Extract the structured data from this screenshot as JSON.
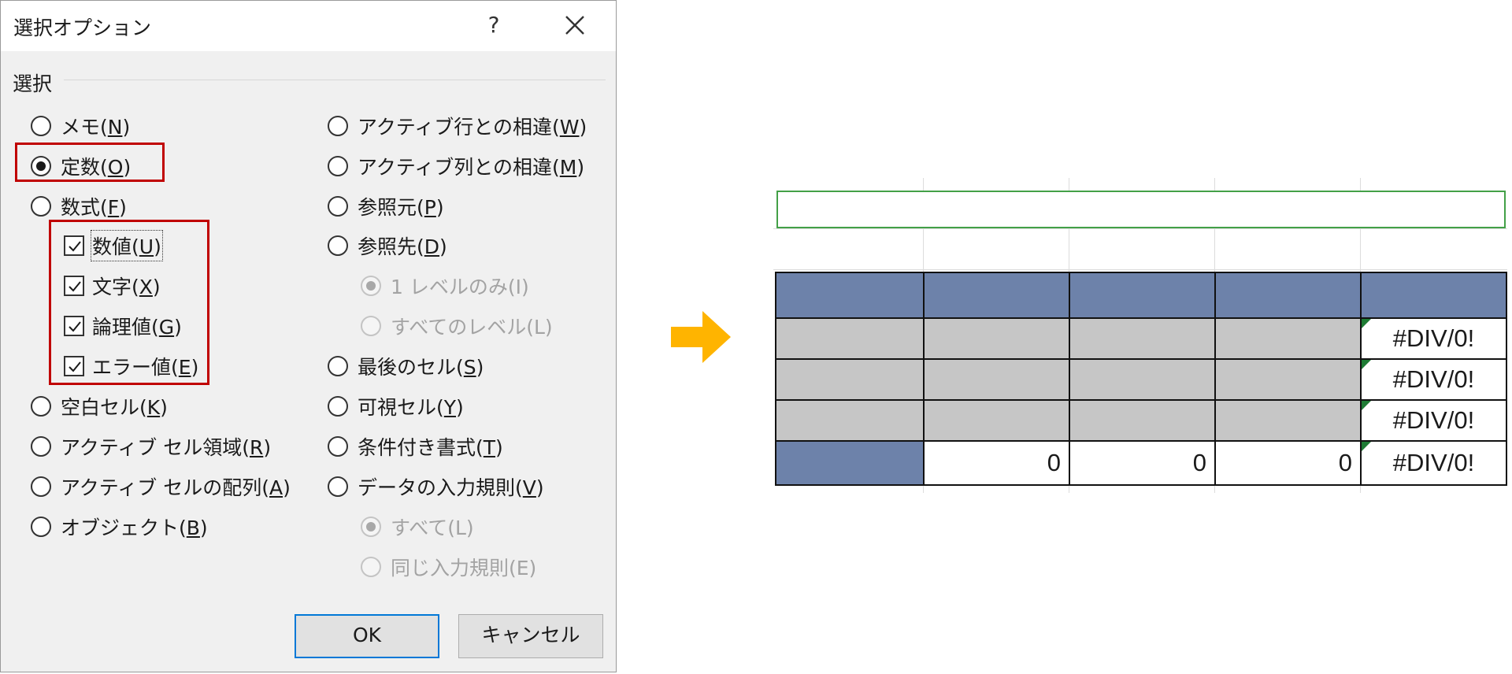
{
  "dialog": {
    "title": "選択オプション",
    "help": "?",
    "group_label": "選択",
    "left_options": [
      {
        "label": "メモ(",
        "key": "N",
        "tail": ")",
        "type": "radio",
        "selected": false
      },
      {
        "label": "定数(",
        "key": "O",
        "tail": ")",
        "type": "radio",
        "selected": true
      },
      {
        "label": "数式(",
        "key": "F",
        "tail": ")",
        "type": "radio",
        "selected": false
      },
      {
        "label": "数値(",
        "key": "U",
        "tail": ")",
        "type": "checkbox",
        "checked": true
      },
      {
        "label": "文字(",
        "key": "X",
        "tail": ")",
        "type": "checkbox",
        "checked": true
      },
      {
        "label": "論理値(",
        "key": "G",
        "tail": ")",
        "type": "checkbox",
        "checked": true
      },
      {
        "label": "エラー値(",
        "key": "E",
        "tail": ")",
        "type": "checkbox",
        "checked": true
      },
      {
        "label": "空白セル(",
        "key": "K",
        "tail": ")",
        "type": "radio",
        "selected": false
      },
      {
        "label": "アクティブ セル領域(",
        "key": "R",
        "tail": ")",
        "type": "radio",
        "selected": false
      },
      {
        "label": "アクティブ セルの配列(",
        "key": "A",
        "tail": ")",
        "type": "radio",
        "selected": false
      },
      {
        "label": "オブジェクト(",
        "key": "B",
        "tail": ")",
        "type": "radio",
        "selected": false
      }
    ],
    "right_options": [
      {
        "label": "アクティブ行との相違(",
        "key": "W",
        "tail": ")",
        "type": "radio",
        "selected": false
      },
      {
        "label": "アクティブ列との相違(",
        "key": "M",
        "tail": ")",
        "type": "radio",
        "selected": false
      },
      {
        "label": "参照元(",
        "key": "P",
        "tail": ")",
        "type": "radio",
        "selected": false
      },
      {
        "label": "参照先(",
        "key": "D",
        "tail": ")",
        "type": "radio",
        "selected": false
      },
      {
        "label": "1 レベルのみ(I)",
        "key": "",
        "tail": "",
        "type": "radio",
        "selected": true,
        "disabled": true
      },
      {
        "label": "すべてのレベル(L)",
        "key": "",
        "tail": "",
        "type": "radio",
        "selected": false,
        "disabled": true
      },
      {
        "label": "最後のセル(",
        "key": "S",
        "tail": ")",
        "type": "radio",
        "selected": false
      },
      {
        "label": "可視セル(",
        "key": "Y",
        "tail": ")",
        "type": "radio",
        "selected": false
      },
      {
        "label": "条件付き書式(",
        "key": "T",
        "tail": ")",
        "type": "radio",
        "selected": false
      },
      {
        "label": "データの入力規則(",
        "key": "V",
        "tail": ")",
        "type": "radio",
        "selected": false
      },
      {
        "label": "すべて(L)",
        "key": "",
        "tail": "",
        "type": "radio",
        "selected": true,
        "disabled": true
      },
      {
        "label": "同じ入力規則(E)",
        "key": "",
        "tail": "",
        "type": "radio",
        "selected": false,
        "disabled": true
      }
    ],
    "ok_label": "OK",
    "cancel_label": "キャンセル"
  },
  "colors": {
    "highlight_box": "#c00000",
    "arrow": "#ffb400",
    "header_fill": "#6d82aa",
    "gray_fill": "#c6c6c6",
    "title_cell_border": "#43a047",
    "error_indicator": "#1e7b34"
  },
  "sheet": {
    "rows": [
      [
        "",
        "",
        "",
        "",
        "#DIV/0!"
      ],
      [
        "",
        "",
        "",
        "",
        "#DIV/0!"
      ],
      [
        "",
        "",
        "",
        "",
        "#DIV/0!"
      ],
      [
        "",
        "0",
        "0",
        "0",
        "#DIV/0!"
      ]
    ]
  }
}
